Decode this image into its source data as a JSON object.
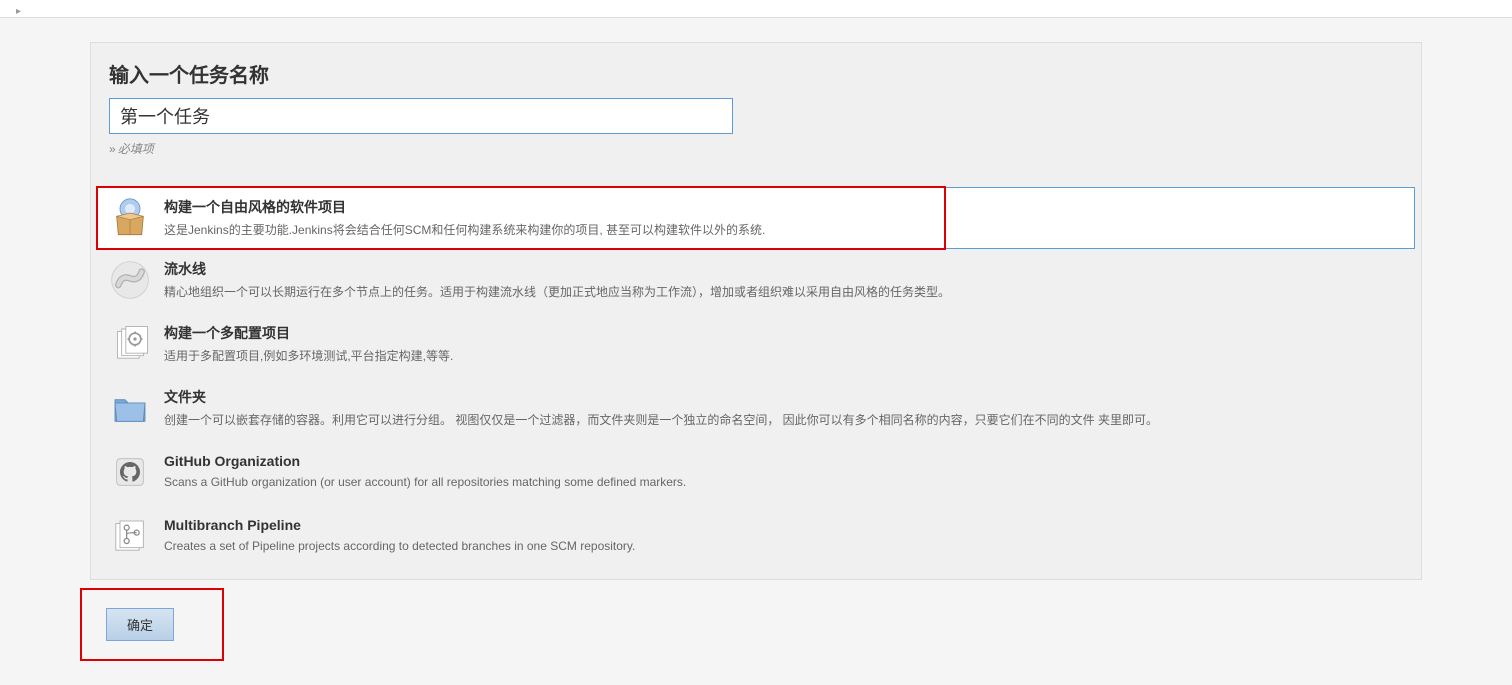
{
  "breadcrumb": {},
  "name_section": {
    "title": "输入一个任务名称",
    "input_value": "第一个任务",
    "required_hint": "必填项"
  },
  "items": [
    {
      "icon": "freestyle-project-icon",
      "title": "构建一个自由风格的软件项目",
      "desc": "这是Jenkins的主要功能.Jenkins将会结合任何SCM和任何构建系统来构建你的项目, 甚至可以构建软件以外的系统.",
      "selected": true
    },
    {
      "icon": "pipeline-icon",
      "title": "流水线",
      "desc": "精心地组织一个可以长期运行在多个节点上的任务。适用于构建流水线（更加正式地应当称为工作流），增加或者组织难以采用自由风格的任务类型。",
      "selected": false
    },
    {
      "icon": "multiconfig-icon",
      "title": "构建一个多配置项目",
      "desc": "适用于多配置项目,例如多环境测试,平台指定构建,等等.",
      "selected": false
    },
    {
      "icon": "folder-icon",
      "title": "文件夹",
      "desc": "创建一个可以嵌套存储的容器。利用它可以进行分组。 视图仅仅是一个过滤器，而文件夹则是一个独立的命名空间， 因此你可以有多个相同名称的内容，只要它们在不同的文件 夹里即可。",
      "selected": false
    },
    {
      "icon": "github-org-icon",
      "title": "GitHub Organization",
      "desc": "Scans a GitHub organization (or user account) for all repositories matching some defined markers.",
      "selected": false
    },
    {
      "icon": "multibranch-icon",
      "title": "Multibranch Pipeline",
      "desc": "Creates a set of Pipeline projects according to detected branches in one SCM repository.",
      "selected": false
    }
  ],
  "footer": {
    "ok_label": "确定"
  }
}
